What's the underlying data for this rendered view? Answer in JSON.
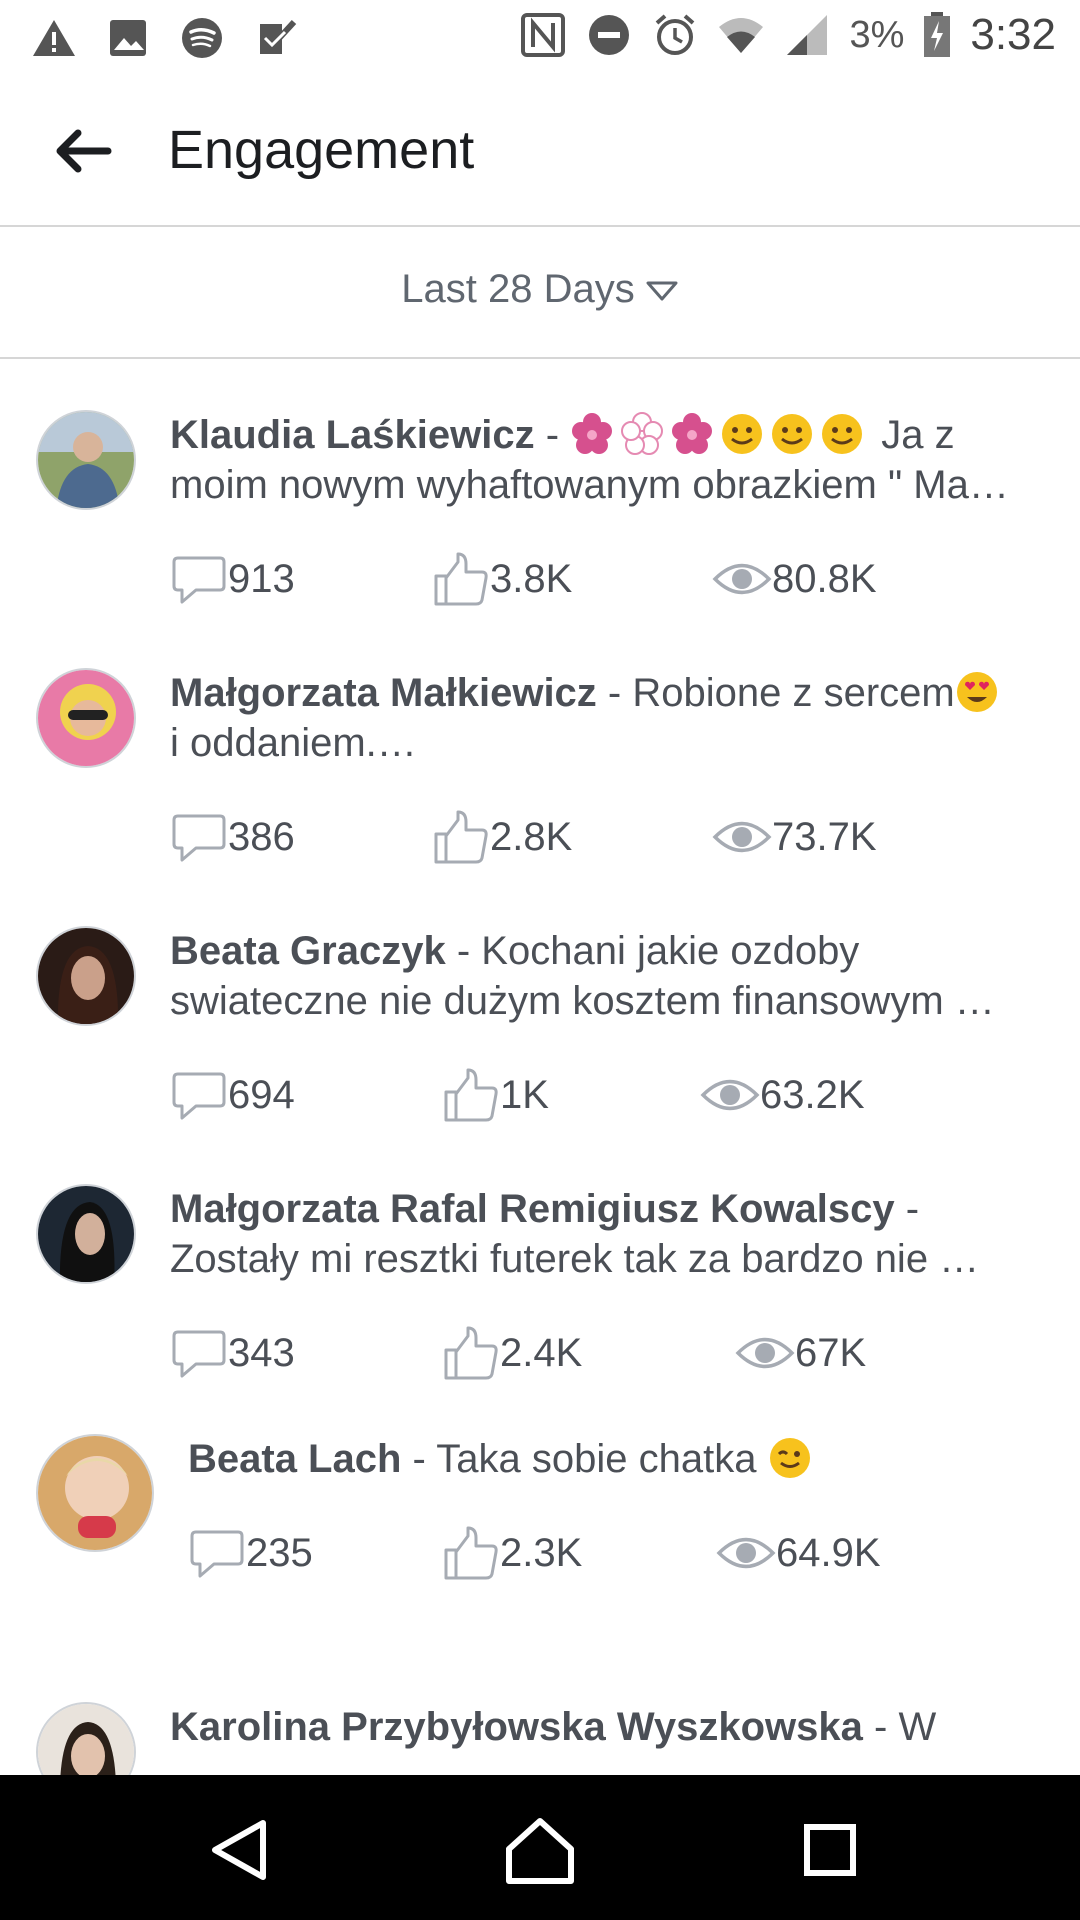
{
  "status_bar": {
    "battery": "3%",
    "time": "3:32",
    "icons": [
      "warning-icon",
      "image-icon",
      "spotify-icon",
      "checkbox-icon",
      "nfc-icon",
      "do-not-disturb-icon",
      "alarm-icon",
      "wifi-icon",
      "signal-icon",
      "battery-icon"
    ]
  },
  "header": {
    "title": "Engagement",
    "back_icon": "back-arrow-icon"
  },
  "filter": {
    "label": "Last 28 Days",
    "icon": "dropdown-triangle-icon"
  },
  "posts": [
    {
      "author": "Klaudia Laśkiewicz",
      "sep": " - ",
      "line1_after": " Ja z",
      "line2": "moim nowym wyhaftowanym obrazkiem \" Ma…",
      "emojis": [
        "flower",
        "flower-outline",
        "flower",
        "smile",
        "smile",
        "smile"
      ],
      "comments": "913",
      "likes": "3.8K",
      "views": "80.8K"
    },
    {
      "author": "Małgorzata Małkiewicz",
      "sep": " - ",
      "line1_after": "Robione z sercem",
      "line2": "i oddaniem.…",
      "emojis": [
        "heart-eyes"
      ],
      "comments": "386",
      "likes": "2.8K",
      "views": "73.7K"
    },
    {
      "author": "Beata Graczyk",
      "sep": " - ",
      "line1_after": "Kochani jakie ozdoby",
      "line2": "swiateczne nie dużym kosztem finansowym …",
      "comments": "694",
      "likes": "1K",
      "views": "63.2K"
    },
    {
      "author": "Małgorzata Rafal Remigiusz Kowalscy",
      "sep": " -",
      "line1_after": "",
      "line2": "Zostały mi resztki  futerek tak za bardzo nie …",
      "comments": "343",
      "likes": "2.4K",
      "views": "67K"
    },
    {
      "author": "Beata Lach",
      "sep": " - ",
      "line1_after": "Taka sobie chatka",
      "line2": "",
      "emojis": [
        "wink"
      ],
      "comments": "235",
      "likes": "2.3K",
      "views": "64.9K"
    },
    {
      "author": "Karolina Przybyłowska Wyszkowska",
      "sep": " - ",
      "line1_after": "W",
      "line2": ""
    }
  ],
  "colors": {
    "text": "#4b4f56",
    "divider": "#d6d6d6",
    "icon_gray": "#8d949e",
    "nav_bg": "#000000"
  },
  "nav": {
    "icons": [
      "back-triangle-icon",
      "home-icon",
      "recents-square-icon"
    ]
  }
}
